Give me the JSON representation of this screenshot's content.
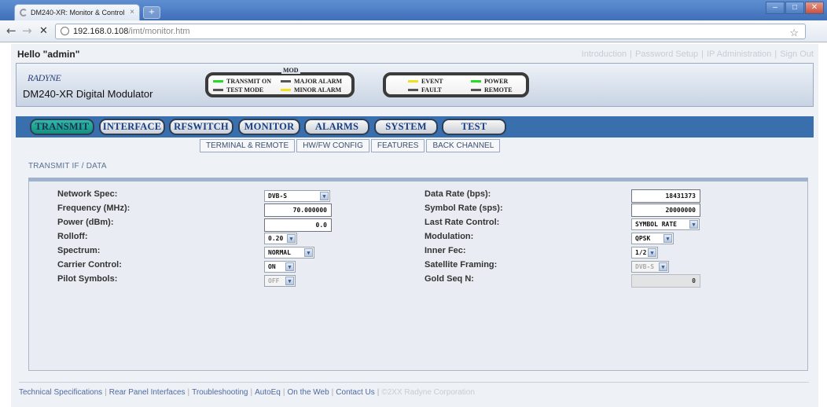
{
  "browser": {
    "tab_title": "DM240-XR: Monitor & Control",
    "tab_close": "×",
    "newtab": "+",
    "url_host": "192.168.0.108",
    "url_path": "/imt/monitor.htm",
    "back": "←",
    "forward": "→",
    "stop": "✕",
    "star": "☆",
    "wrench": "🔧",
    "min": "–",
    "max": "□",
    "close": "✕"
  },
  "header": {
    "greeting": "Hello \"admin\"",
    "links": [
      "Introduction",
      "Password Setup",
      "IP Administration",
      "Sign Out"
    ],
    "link_sep": "|",
    "logo": "RADYNE",
    "product": "DM240-XR Digital Modulator",
    "mod_title": "MOD",
    "mod_leds": [
      {
        "label": "TRANSMIT ON",
        "color": "green"
      },
      {
        "label": "MAJOR ALARM",
        "color": "gray"
      },
      {
        "label": "TEST MODE",
        "color": "gray"
      },
      {
        "label": "MINOR ALARM",
        "color": "yellow"
      }
    ],
    "status_leds": [
      {
        "label": "EVENT",
        "color": "yellow"
      },
      {
        "label": "POWER",
        "color": "green"
      },
      {
        "label": "FAULT",
        "color": "gray"
      },
      {
        "label": "REMOTE",
        "color": "gray"
      }
    ],
    "colors": {
      "green": "#22dd22",
      "yellow": "#f0e020",
      "gray": "#555555"
    }
  },
  "tabs": [
    "TRANSMIT",
    "INTERFACE",
    "RFSWITCH",
    "MONITOR",
    "ALARMS",
    "SYSTEM",
    "TEST"
  ],
  "active_tab": "TRANSMIT",
  "subtabs": [
    "TERMINAL & REMOTE",
    "HW/FW CONFIG",
    "FEATURES",
    "BACK CHANNEL"
  ],
  "section_title": "TRANSMIT IF / DATA",
  "left_fields": {
    "network_spec": {
      "label": "Network Spec:",
      "value": "DVB-S"
    },
    "frequency": {
      "label": "Frequency (MHz):",
      "value": "70.000000"
    },
    "power": {
      "label": "Power (dBm):",
      "value": "0.0"
    },
    "rolloff": {
      "label": "Rolloff:",
      "value": "0.20"
    },
    "spectrum": {
      "label": "Spectrum:",
      "value": "NORMAL"
    },
    "carrier_control": {
      "label": "Carrier Control:",
      "value": "ON"
    },
    "pilot_symbols": {
      "label": "Pilot Symbols:",
      "value": "OFF"
    }
  },
  "right_fields": {
    "data_rate": {
      "label": "Data Rate (bps):",
      "value": "18431373"
    },
    "symbol_rate": {
      "label": "Symbol Rate (sps):",
      "value": "20000000"
    },
    "last_rate_control": {
      "label": "Last Rate Control:",
      "value": "SYMBOL RATE"
    },
    "modulation": {
      "label": "Modulation:",
      "value": "QPSK"
    },
    "inner_fec": {
      "label": "Inner Fec:",
      "value": "1/2"
    },
    "satellite_framing": {
      "label": "Satellite Framing:",
      "value": "DVB-S"
    },
    "gold_seq": {
      "label": "Gold Seq N:",
      "value": "0"
    }
  },
  "footer": {
    "links": [
      "Technical Specifications",
      "Rear Panel Interfaces",
      "Troubleshooting",
      "AutoEq",
      "On the Web",
      "Contact Us"
    ],
    "sep": "|",
    "copyright": "©2XX Radyne Corporation"
  }
}
